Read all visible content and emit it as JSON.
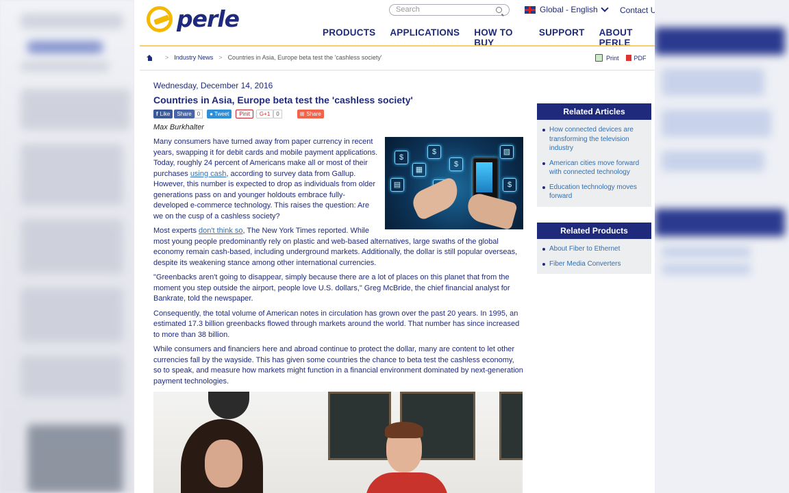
{
  "site": {
    "brand": "perle"
  },
  "header": {
    "search_placeholder": "Search",
    "region": "Global - English",
    "contact": "Contact Us",
    "nav": [
      "PRODUCTS",
      "APPLICATIONS",
      "HOW TO BUY",
      "SUPPORT",
      "ABOUT PERLE"
    ]
  },
  "breadcrumb": [
    "Industry News",
    "Countries in Asia, Europe beta test the 'cashless society'"
  ],
  "tools": {
    "print": "Print",
    "pdf": "PDF"
  },
  "article": {
    "date": "Wednesday, December 14, 2016",
    "title": "Countries in Asia, Europe beta test the 'cashless society'",
    "author": "Max Burkhalter",
    "share": {
      "fb_like": "Like",
      "fb_share": "Share",
      "fb_count": "0",
      "tweet": "Tweet",
      "pin": "Pinit",
      "gplus": "G+1",
      "gplus_count": "0",
      "share": "Share"
    },
    "p1_before_link": "Many consumers have turned away from paper currency in recent years, swapping it for debit cards and mobile payment applications. Today, roughly 24 percent of Americans make all or most of their purchases ",
    "p1_link": "using cash",
    "p1_after_link": ", according to survey data from Gallup. However, this number is expected to drop as individuals from older generations pass on and younger holdouts embrace fully-developed e-commerce technology. This raises the question: Are we on the cusp of a cashless society?",
    "p2_before_link": "Most experts ",
    "p2_link": "don't think so",
    "p2_after_link": ", The New York Times reported. While most young people predominantly rely on plastic and web-based alternatives, large swaths of the global economy remain cash-based, including underground markets. Additionally, the dollar is still popular overseas, despite its weakening stance among other international currencies.",
    "p3": "\"Greenbacks aren't going to disappear, simply because there are a lot of places on this planet that from the moment you step outside the airport, people love U.S. dollars,\" Greg McBride, the chief financial analyst for Bankrate, told the newspaper.",
    "p4": "Consequently, the total volume of American notes in circulation has grown over the past 20 years. In 1995, an estimated 17.3 billion greenbacks flowed through markets around the world. That number has since increased to more than 38 billion.",
    "p5": "While consumers and financiers here and abroad continue to protect the dollar, many are content to let other currencies fall by the wayside. This has given some countries the chance to beta test the cashless economy, so to speak, and measure how markets might function in a financial environment dominated by next-generation payment technologies."
  },
  "sidebar": {
    "related_articles_title": "Related Articles",
    "related_articles": [
      "How connected devices are transforming the television industry",
      "American cities move forward with connected technology",
      "Education technology moves forward"
    ],
    "related_products_title": "Related Products",
    "related_products": [
      "About Fiber to Ethernet",
      "Fiber Media Converters"
    ]
  },
  "colors": {
    "brand_navy": "#1f2a7c",
    "brand_yellow": "#f5b800",
    "link_blue": "#2f6fb3"
  }
}
